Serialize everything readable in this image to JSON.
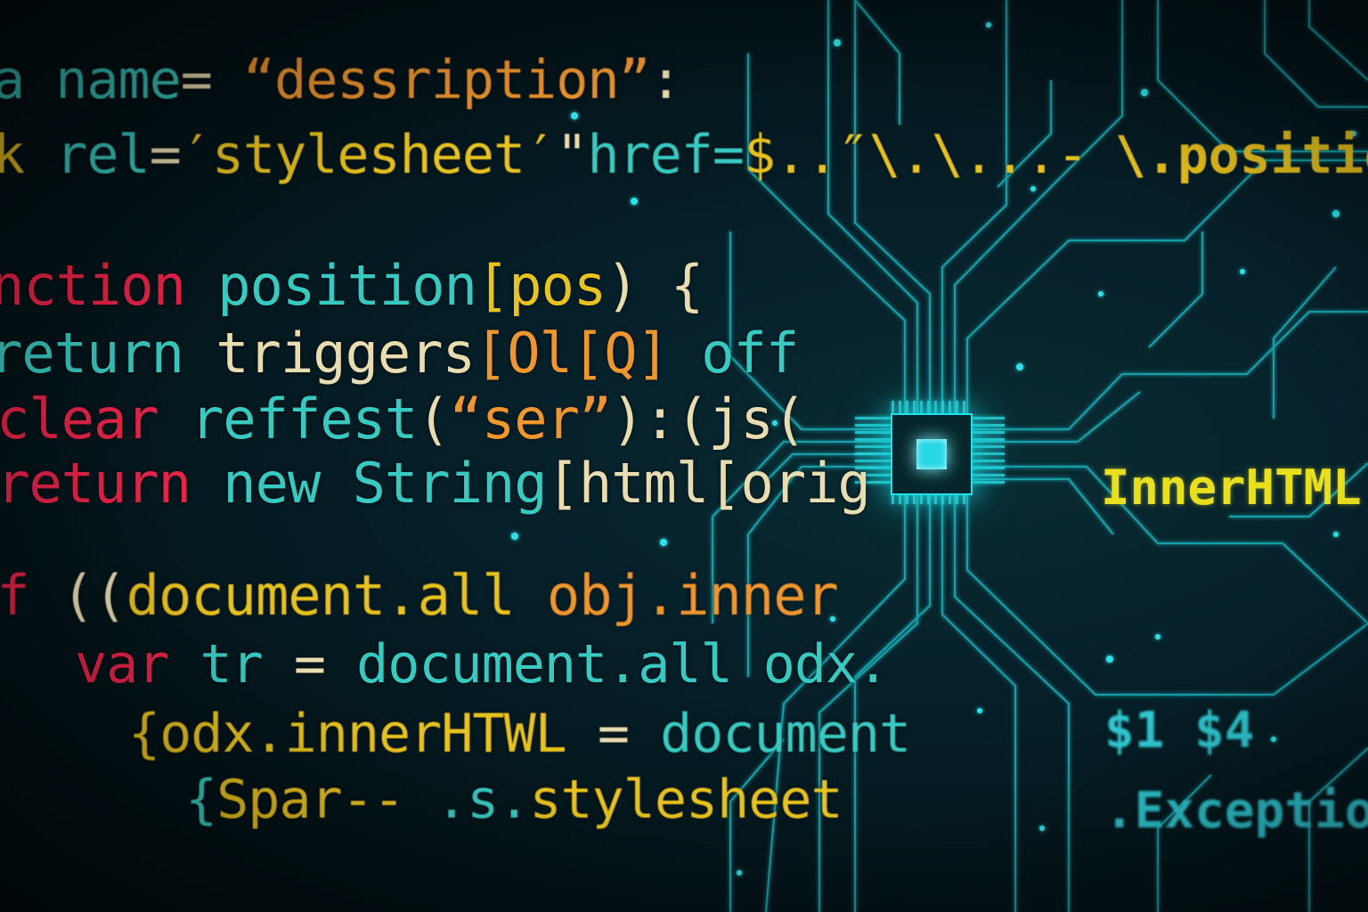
{
  "colors": {
    "background": "#041a1f",
    "circuit": "#1fc7d0",
    "chip_glow": "#2ee8f0",
    "keyword_red": "#e8234a",
    "string_orange": "#f0962e",
    "identifier_teal": "#38c9c0",
    "identifier_yellow": "#e8c21e",
    "punct_cream": "#e8dcb0"
  },
  "code_lines": [
    {
      "id": "line-meta",
      "tokens": [
        {
          "text": "a name",
          "color": "#38c9c0"
        },
        {
          "text": "= ",
          "color": "#e8dcb0"
        },
        {
          "text": "“dessription”",
          "color": "#f0962e"
        },
        {
          "text": ":",
          "color": "#e8dcb0"
        }
      ]
    },
    {
      "id": "line-link",
      "tokens": [
        {
          "text": "k ",
          "color": "#e8c21e"
        },
        {
          "text": "rel",
          "color": "#38c9c0"
        },
        {
          "text": "=",
          "color": "#e8dcb0"
        },
        {
          "text": "′stylesheet′",
          "color": "#e8c21e"
        },
        {
          "text": "\"",
          "color": "#e8dcb0"
        },
        {
          "text": "href",
          "color": "#38c9c0"
        },
        {
          "text": "=",
          "color": "#38c9c0"
        },
        {
          "text": "$..",
          "color": "#e8c21e"
        },
        {
          "text": "″\\.\\...‑",
          "color": "#e8c21e"
        }
      ]
    },
    {
      "id": "line-function",
      "tokens": [
        {
          "text": "nction ",
          "color": "#e8234a"
        },
        {
          "text": "position",
          "color": "#38c9c0"
        },
        {
          "text": "[",
          "color": "#e8c21e"
        },
        {
          "text": "pos",
          "color": "#e8c21e"
        },
        {
          "text": ") {",
          "color": "#e8dcb0"
        }
      ]
    },
    {
      "id": "line-return-triggers",
      "tokens": [
        {
          "text": "return ",
          "color": "#38c9c0"
        },
        {
          "text": "triggers",
          "color": "#e8dcb0"
        },
        {
          "text": "[Ol[Q] ",
          "color": "#f0962e"
        },
        {
          "text": "off",
          "color": "#38c9c0"
        }
      ]
    },
    {
      "id": "line-clear",
      "tokens": [
        {
          "text": "clear ",
          "color": "#e8234a"
        },
        {
          "text": "reffest",
          "color": "#38c9c0"
        },
        {
          "text": "(",
          "color": "#e8dcb0"
        },
        {
          "text": "“ser”",
          "color": "#f0962e"
        },
        {
          "text": "):(js(",
          "color": "#e8dcb0"
        }
      ]
    },
    {
      "id": "line-return-string",
      "tokens": [
        {
          "text": "return ",
          "color": "#e8234a"
        },
        {
          "text": "new ",
          "color": "#38c9c0"
        },
        {
          "text": "String",
          "color": "#38c9c0"
        },
        {
          "text": "[html[orig",
          "color": "#e8dcb0"
        }
      ]
    },
    {
      "id": "line-if",
      "tokens": [
        {
          "text": "if ",
          "color": "#e8234a"
        },
        {
          "text": "((",
          "color": "#e8dcb0"
        },
        {
          "text": "document.all ",
          "color": "#e8c21e"
        },
        {
          "text": "obj.inner",
          "color": "#f0962e"
        }
      ]
    },
    {
      "id": "line-var",
      "tokens": [
        {
          "text": "var ",
          "color": "#e8234a"
        },
        {
          "text": "tr ",
          "color": "#38c9c0"
        },
        {
          "text": "= ",
          "color": "#e8dcb0"
        },
        {
          "text": "document.all ",
          "color": "#38c9c0"
        },
        {
          "text": "odx.",
          "color": "#38c9c0"
        }
      ]
    },
    {
      "id": "line-odx",
      "tokens": [
        {
          "text": "{",
          "color": "#e8c21e"
        },
        {
          "text": "odx.innerHTWL ",
          "color": "#e8c21e"
        },
        {
          "text": "= ",
          "color": "#e8dcb0"
        },
        {
          "text": "document",
          "color": "#38c9c0"
        }
      ]
    },
    {
      "id": "line-spar",
      "tokens": [
        {
          "text": "{",
          "color": "#38c9c0"
        },
        {
          "text": "Spar-- ",
          "color": "#e8c21e"
        },
        {
          "text": ".s.",
          "color": "#38c9c0"
        },
        {
          "text": "stylesheet",
          "color": "#e8c21e"
        }
      ]
    }
  ],
  "side_texts": [
    {
      "id": "position-label",
      "text": "\\.positio",
      "color": "#e8c21e"
    },
    {
      "id": "innerhtml-label",
      "text": "InnerHTML",
      "color": "#e8e01e"
    },
    {
      "id": "dollar-label",
      "text": "$1 $4",
      "color": "#2fc6cf"
    },
    {
      "id": "exception-label",
      "text": ".Exceptio",
      "color": "#2fc6cf"
    }
  ]
}
